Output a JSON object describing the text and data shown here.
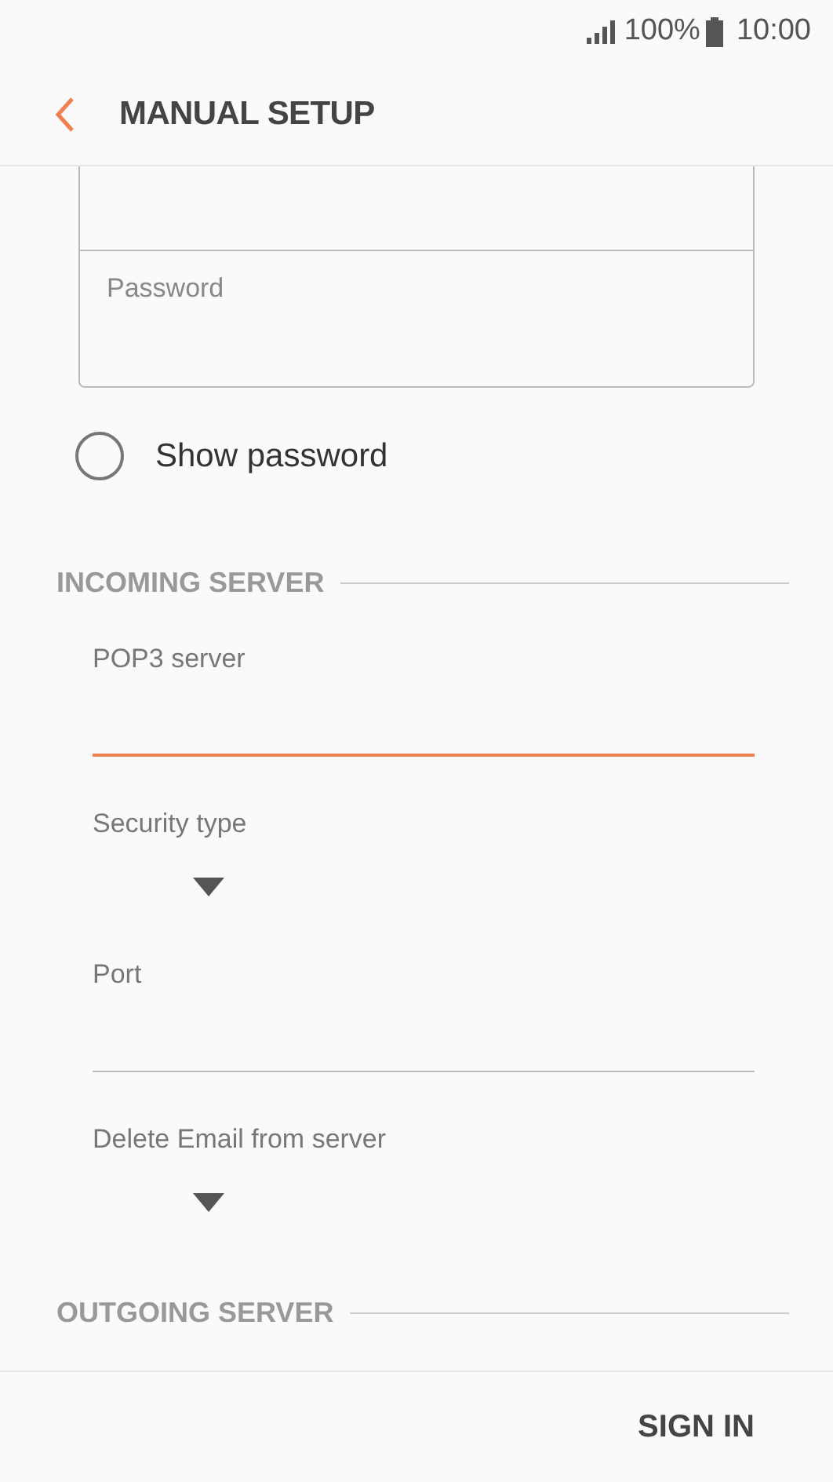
{
  "status_bar": {
    "battery": "100%",
    "time": "10:00"
  },
  "header": {
    "title": "MANUAL SETUP"
  },
  "password_field": {
    "placeholder": "Password"
  },
  "show_password": {
    "label": "Show password",
    "checked": false
  },
  "sections": [
    {
      "title": "INCOMING SERVER",
      "fields": [
        {
          "kind": "text",
          "label": "POP3 server",
          "focused": true
        },
        {
          "kind": "dropdown",
          "label": "Security type"
        },
        {
          "kind": "text",
          "label": "Port",
          "focused": false
        },
        {
          "kind": "dropdown",
          "label": "Delete Email from server"
        }
      ]
    },
    {
      "title": "OUTGOING SERVER"
    }
  ],
  "bottom_bar": {
    "button": "SIGN IN"
  }
}
